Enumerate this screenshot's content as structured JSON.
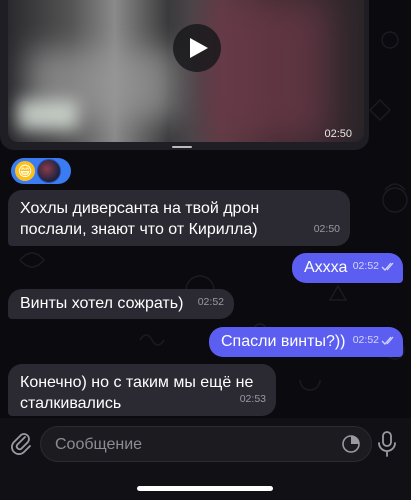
{
  "video": {
    "duration": "02:50",
    "play_icon": "play-icon"
  },
  "reactions": {
    "emoji": "😁",
    "avatar_icon": "reaction-avatar"
  },
  "messages": [
    {
      "direction": "in",
      "text": "Хохлы диверсанта на твой дрон послали, знают что от Кирилла)",
      "time": "02:50"
    },
    {
      "direction": "out",
      "text": "Аххха",
      "time": "02:52",
      "read": true
    },
    {
      "direction": "in",
      "text": "Винты хотел сожрать)",
      "time": "02:52"
    },
    {
      "direction": "out",
      "text": "Спасли винты?))",
      "time": "02:52",
      "read": true
    },
    {
      "direction": "in",
      "text": "Конечно) но с таким мы ещё не сталкивались",
      "time": "02:53"
    }
  ],
  "composer": {
    "placeholder": "Сообщение",
    "attach_icon": "paperclip-icon",
    "sticker_icon": "sticker-icon",
    "mic_icon": "microphone-icon"
  },
  "colors": {
    "background": "#0b0b0f",
    "incoming_bubble": "#2b2a33",
    "outgoing_bubble": "#5b5ef0",
    "reaction_pill": "#3c7cf3"
  }
}
